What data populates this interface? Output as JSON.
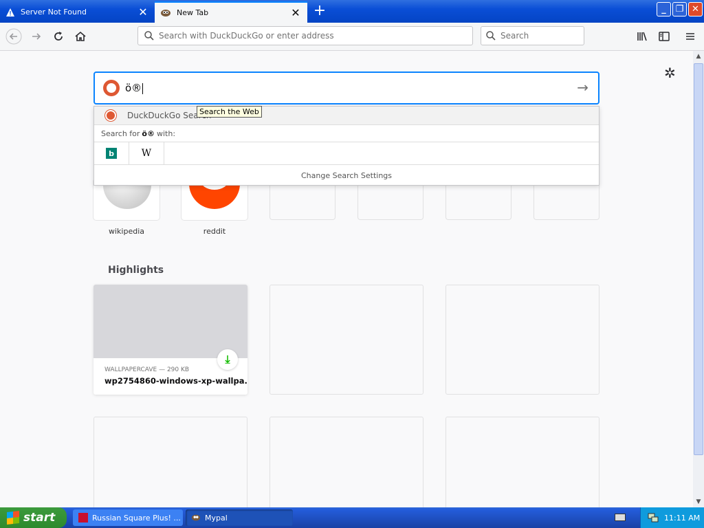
{
  "tabs": [
    {
      "title": "Server Not Found",
      "icon": "warning-icon",
      "active": false
    },
    {
      "title": "New Tab",
      "icon": "mypal-icon",
      "active": true
    }
  ],
  "toolbar": {
    "url_placeholder": "Search with DuckDuckGo or enter address",
    "search_placeholder": "Search"
  },
  "ntp": {
    "search_value": "ö®",
    "dropdown": {
      "first_row": "DuckDuckGo Search",
      "search_for_prefix": "Search for",
      "search_for_term": "ö®",
      "search_for_suffix": "with:",
      "engines": [
        "bing",
        "wikipedia"
      ],
      "change_settings": "Change Search Settings"
    },
    "tooltip": "Search the Web",
    "top_sites": [
      {
        "label": "wikipedia"
      },
      {
        "label": "reddit"
      }
    ],
    "highlights_title": "Highlights",
    "highlight": {
      "source": "WALLPAPERCAVE — 290 KB",
      "name": "wp2754860-windows-xp-wallpa..."
    }
  },
  "taskbar": {
    "start_label": "start",
    "items": [
      {
        "label": "Russian Square Plus! ..."
      },
      {
        "label": "Mypal"
      }
    ],
    "clock": "11:11 AM"
  },
  "colors": {
    "accent": "#0a84ff",
    "ddg": "#de5833",
    "reddit": "#ff4500",
    "download": "#12bc00"
  }
}
